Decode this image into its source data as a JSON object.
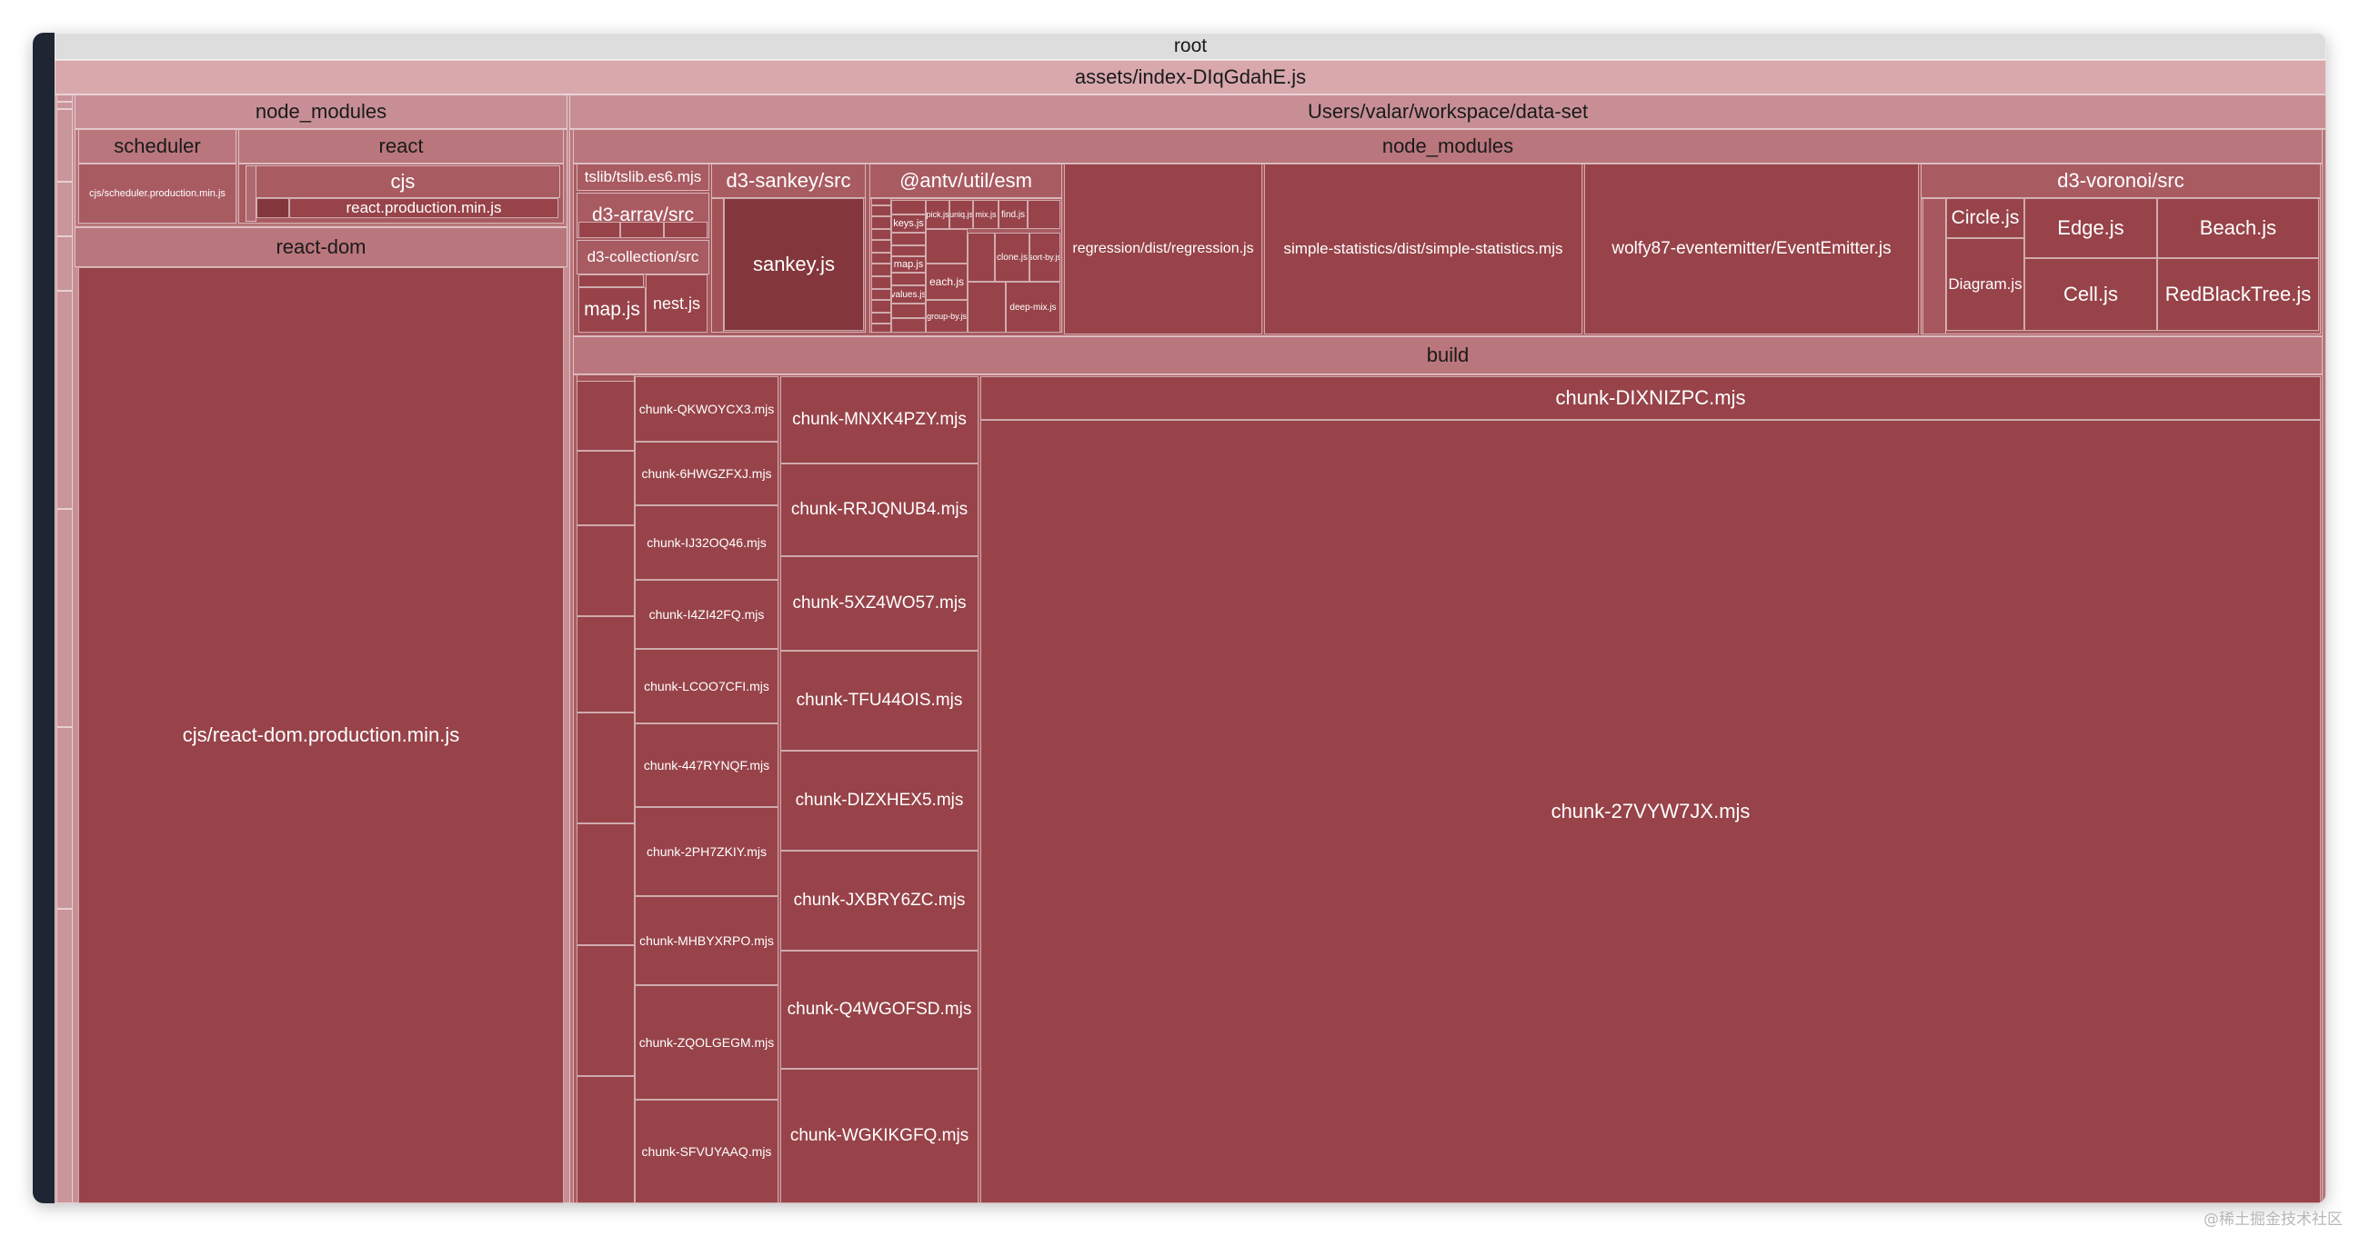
{
  "labels": {
    "root": "root",
    "bundle": "assets/index-DIqGdahE.js",
    "nm_left": "node_modules",
    "scheduler": "scheduler",
    "scheduler_file": "cjs/scheduler.production.min.js",
    "react": "react",
    "react_cjs": "cjs",
    "react_file": "react.production.min.js",
    "react_dom": "react-dom",
    "react_dom_file": "cjs/react-dom.production.min.js",
    "workspace": "Users/valar/workspace/data-set",
    "nm_right": "node_modules",
    "tslib": "tslib/tslib.es6.mjs",
    "d3_array": "d3-array/src",
    "d3_collection": "d3-collection/src",
    "map_js": "map.js",
    "nest_js": "nest.js",
    "d3_sankey": "d3-sankey/src",
    "sankey_js": "sankey.js",
    "antv": "@antv/util/esm",
    "keys_js": "keys.js",
    "map_js_2": "map.js",
    "values_js": "values.js",
    "pick_js": "pick.js",
    "uniq_js": "uniq.js",
    "mix_js": "mix.js",
    "find_js": "find.js",
    "each_js": "each.js",
    "clone_js": "clone.js",
    "sort_by_js": "sort-by.js",
    "group_by_js": "group-by.js",
    "deep_mix_js": "deep-mix.js",
    "regression": "regression/dist/regression.js",
    "simple_stats": "simple-statistics/dist/simple-statistics.mjs",
    "eventemitter": "wolfy87-eventemitter/EventEmitter.js",
    "d3_voronoi": "d3-voronoi/src",
    "circle_js": "Circle.js",
    "diagram_js": "Diagram.js",
    "edge_js": "Edge.js",
    "cell_js": "Cell.js",
    "beach_js": "Beach.js",
    "rbtree_js": "RedBlackTree.js",
    "build": "build",
    "chunk_col1": [
      "chunk-QKWOYCX3.mjs",
      "chunk-6HWGZFXJ.mjs",
      "chunk-IJ32OQ46.mjs",
      "chunk-I4ZI42FQ.mjs",
      "chunk-LCOO7CFI.mjs",
      "chunk-447RYNQF.mjs",
      "chunk-2PH7ZKIY.mjs",
      "chunk-MHBYXRPO.mjs",
      "chunk-ZQOLGEGM.mjs",
      "chunk-SFVUYAAQ.mjs"
    ],
    "chunk_col2": [
      "chunk-MNXK4PZY.mjs",
      "chunk-RRJQNUB4.mjs",
      "chunk-5XZ4WO57.mjs",
      "chunk-TFU44OIS.mjs",
      "chunk-DIZXHEX5.mjs",
      "chunk-JXBRY6ZC.mjs",
      "chunk-Q4WGOFSD.mjs",
      "chunk-WGKIKGFQ.mjs"
    ],
    "chunk_dixnizpc": "chunk-DIXNIZPC.mjs",
    "chunk_main": "chunk-27VYW7JX.mjs"
  },
  "colors": {
    "root_header": "#dddddd",
    "bundle_header": "#d8a8ad",
    "tier_2": "#c78f95",
    "tier_3": "#b9767c",
    "tier_4": "#a95b62",
    "leaf": "#974349",
    "leaf_dark": "#83363b"
  },
  "watermark": "@稀土掘金技术社区"
}
